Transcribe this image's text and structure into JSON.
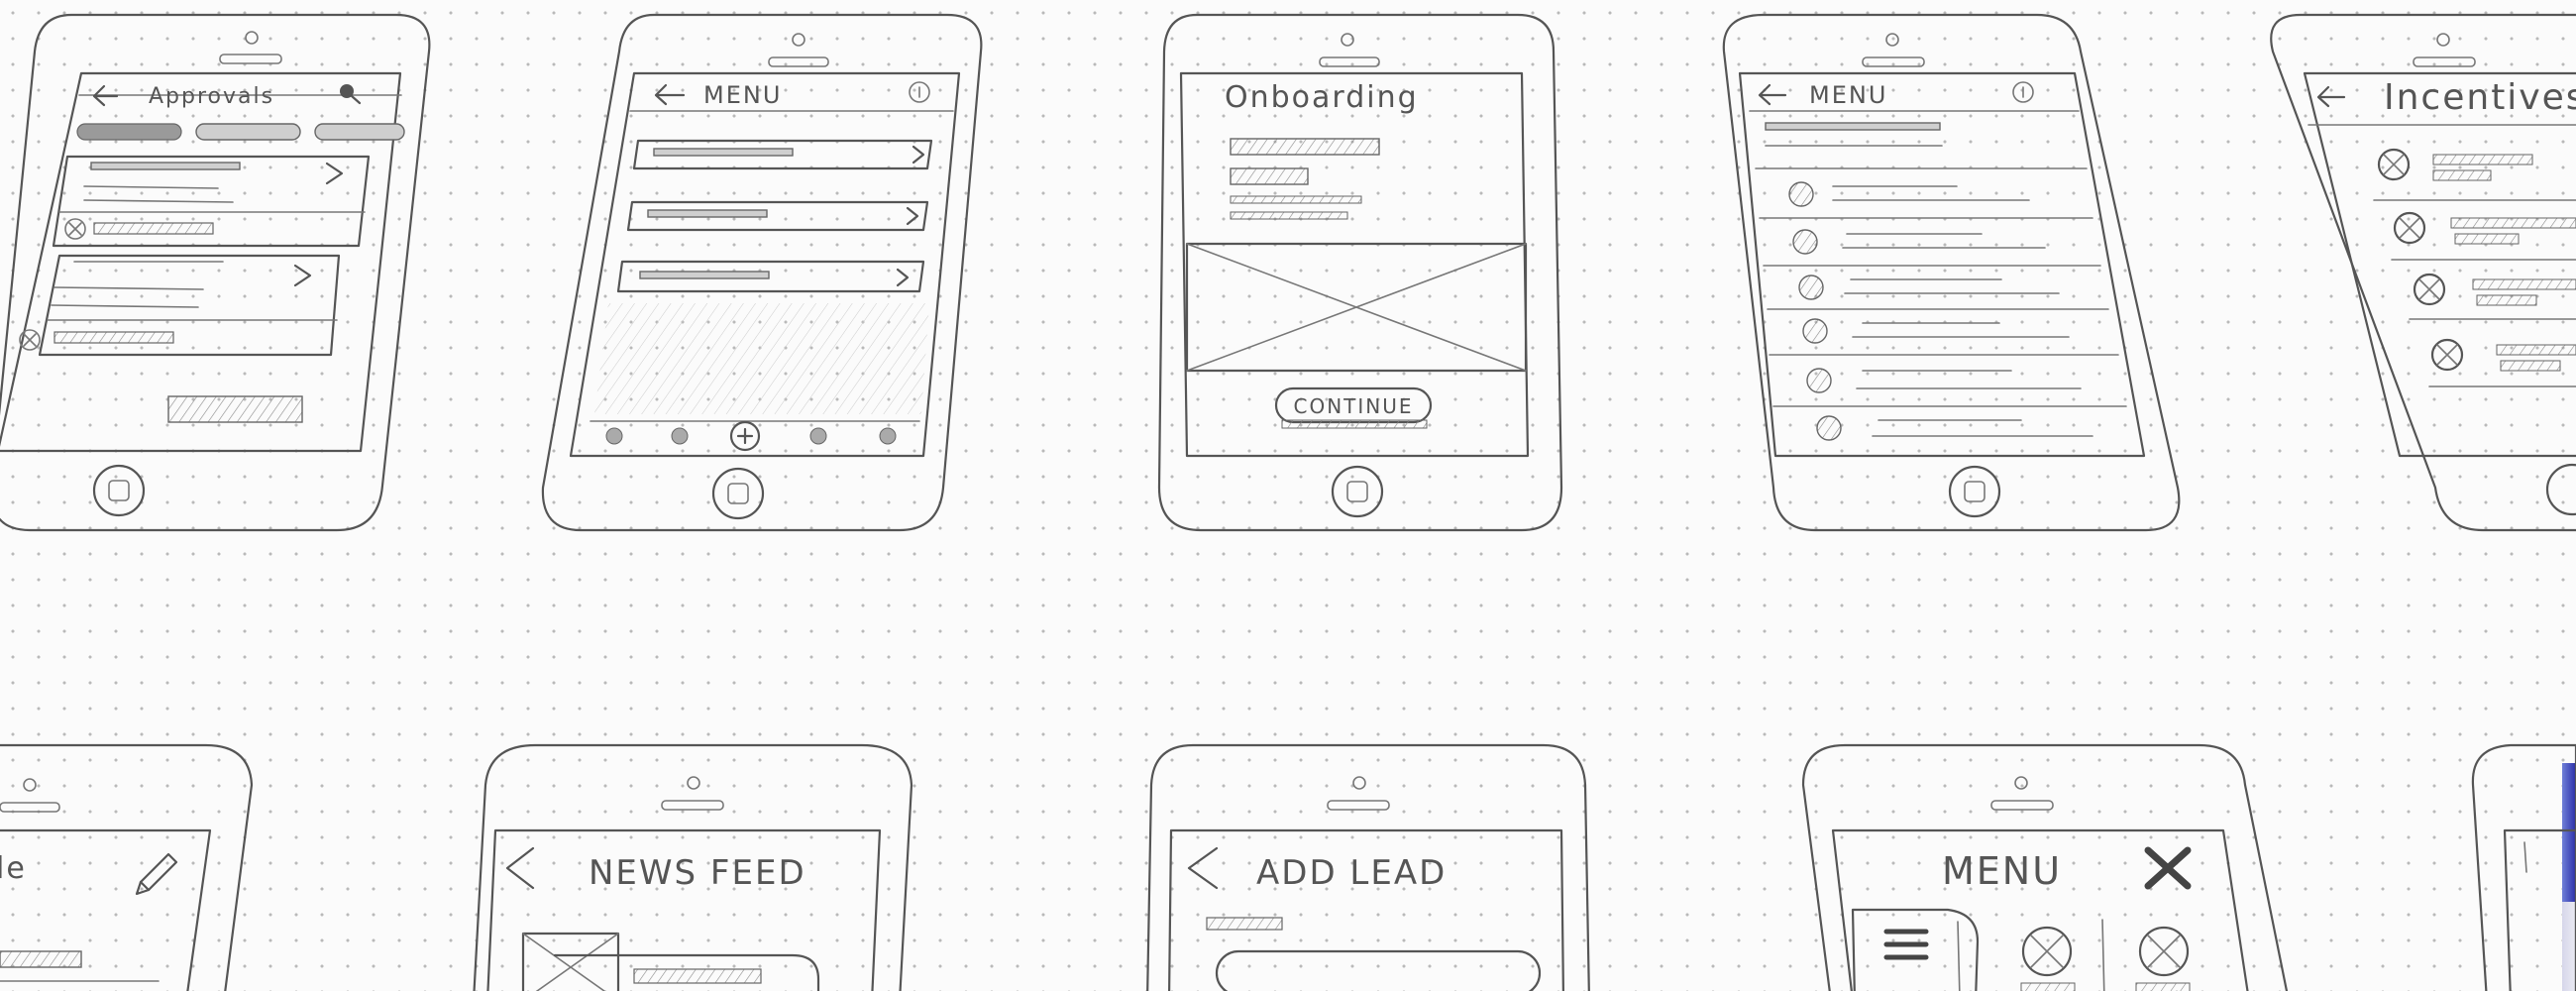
{
  "screens": {
    "approvals": {
      "title": "Approvals"
    },
    "menu1": {
      "title": "MENU"
    },
    "onboarding": {
      "title": "Onboarding",
      "button": "CONTINUE"
    },
    "menu2": {
      "title": "MENU"
    },
    "incentives": {
      "title": "Incentives"
    },
    "profile": {
      "title": "le"
    },
    "news_feed": {
      "title": "NEWS FEED"
    },
    "add_lead": {
      "title": "ADD LEAD"
    },
    "menu3": {
      "title": "MENU"
    }
  }
}
